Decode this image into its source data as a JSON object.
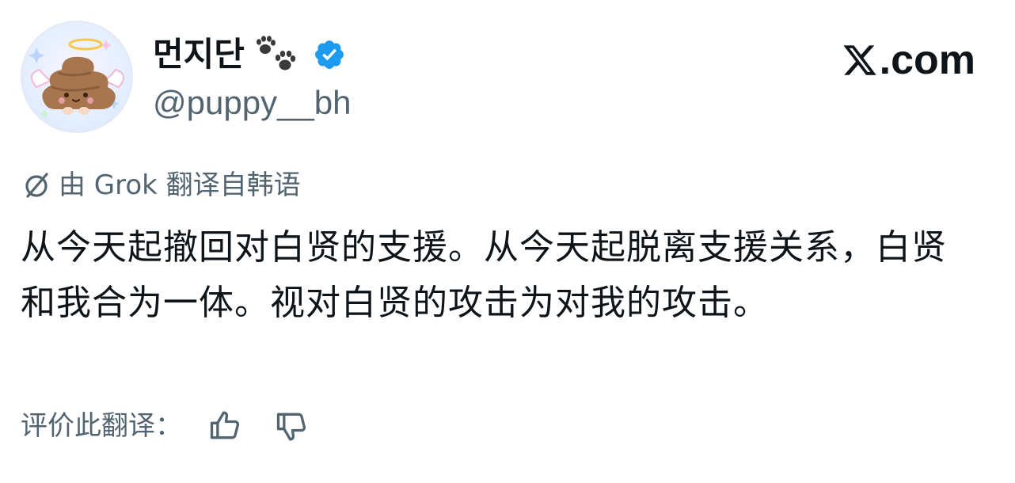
{
  "author": {
    "display_name": "먼지단",
    "handle": "@puppy__bh",
    "avatar_icon": "poop-angel-avatar",
    "name_decoration_icon": "paw-prints-icon",
    "verified_icon": "verified-badge-icon",
    "verified_color": "#1d9bf0"
  },
  "brand": {
    "logo_icon": "x-logo-icon",
    "domain_text": ".com"
  },
  "translation": {
    "icon": "grok-icon",
    "note": "由 Grok 翻译自韩语",
    "text": "从今天起撤回对白贤的支援。从今天起脱离支援关系，白贤和我合为一体。视对白贤的攻击为对我的攻击。"
  },
  "rating": {
    "label": "评价此翻译：",
    "thumbs_up_icon": "thumbs-up-icon",
    "thumbs_down_icon": "thumbs-down-icon"
  },
  "colors": {
    "text_primary": "#0f1419",
    "text_secondary": "#536471",
    "accent": "#1d9bf0"
  }
}
